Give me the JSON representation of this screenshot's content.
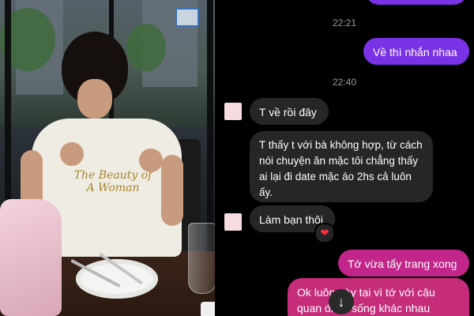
{
  "photo": {
    "shirt_text": "The Beauty of A Woman"
  },
  "chat": {
    "timestamps": [
      "22:21",
      "22:40"
    ],
    "messages": [
      {
        "side": "out",
        "text": "Về thì nhắn nhaa"
      },
      {
        "side": "in",
        "text": "T về rồi đây"
      },
      {
        "side": "in",
        "text": "T thấy t với bà không hợp, từ cách nói chuyện ăn mặc tôi chẳng thấy ai lại đi date mặc áo 2hs cả luôn ấy."
      },
      {
        "side": "in",
        "text": "Làm bạn thôi"
      },
      {
        "side": "out",
        "text": "Tớ vừa tẩy trang xong"
      },
      {
        "side": "out",
        "text": "Ok luôn này tại vì tớ với cậu quan điểm sống khác nhau"
      }
    ],
    "reaction_icon": "heart-icon",
    "reaction_glyph": "❤",
    "scroll_icon": "arrow-down-icon",
    "scroll_glyph": "↓",
    "colors": {
      "outgoing_purple": "#7a32e6",
      "outgoing_pink": "#c2268a",
      "incoming": "#262626",
      "background": "#000000"
    }
  }
}
